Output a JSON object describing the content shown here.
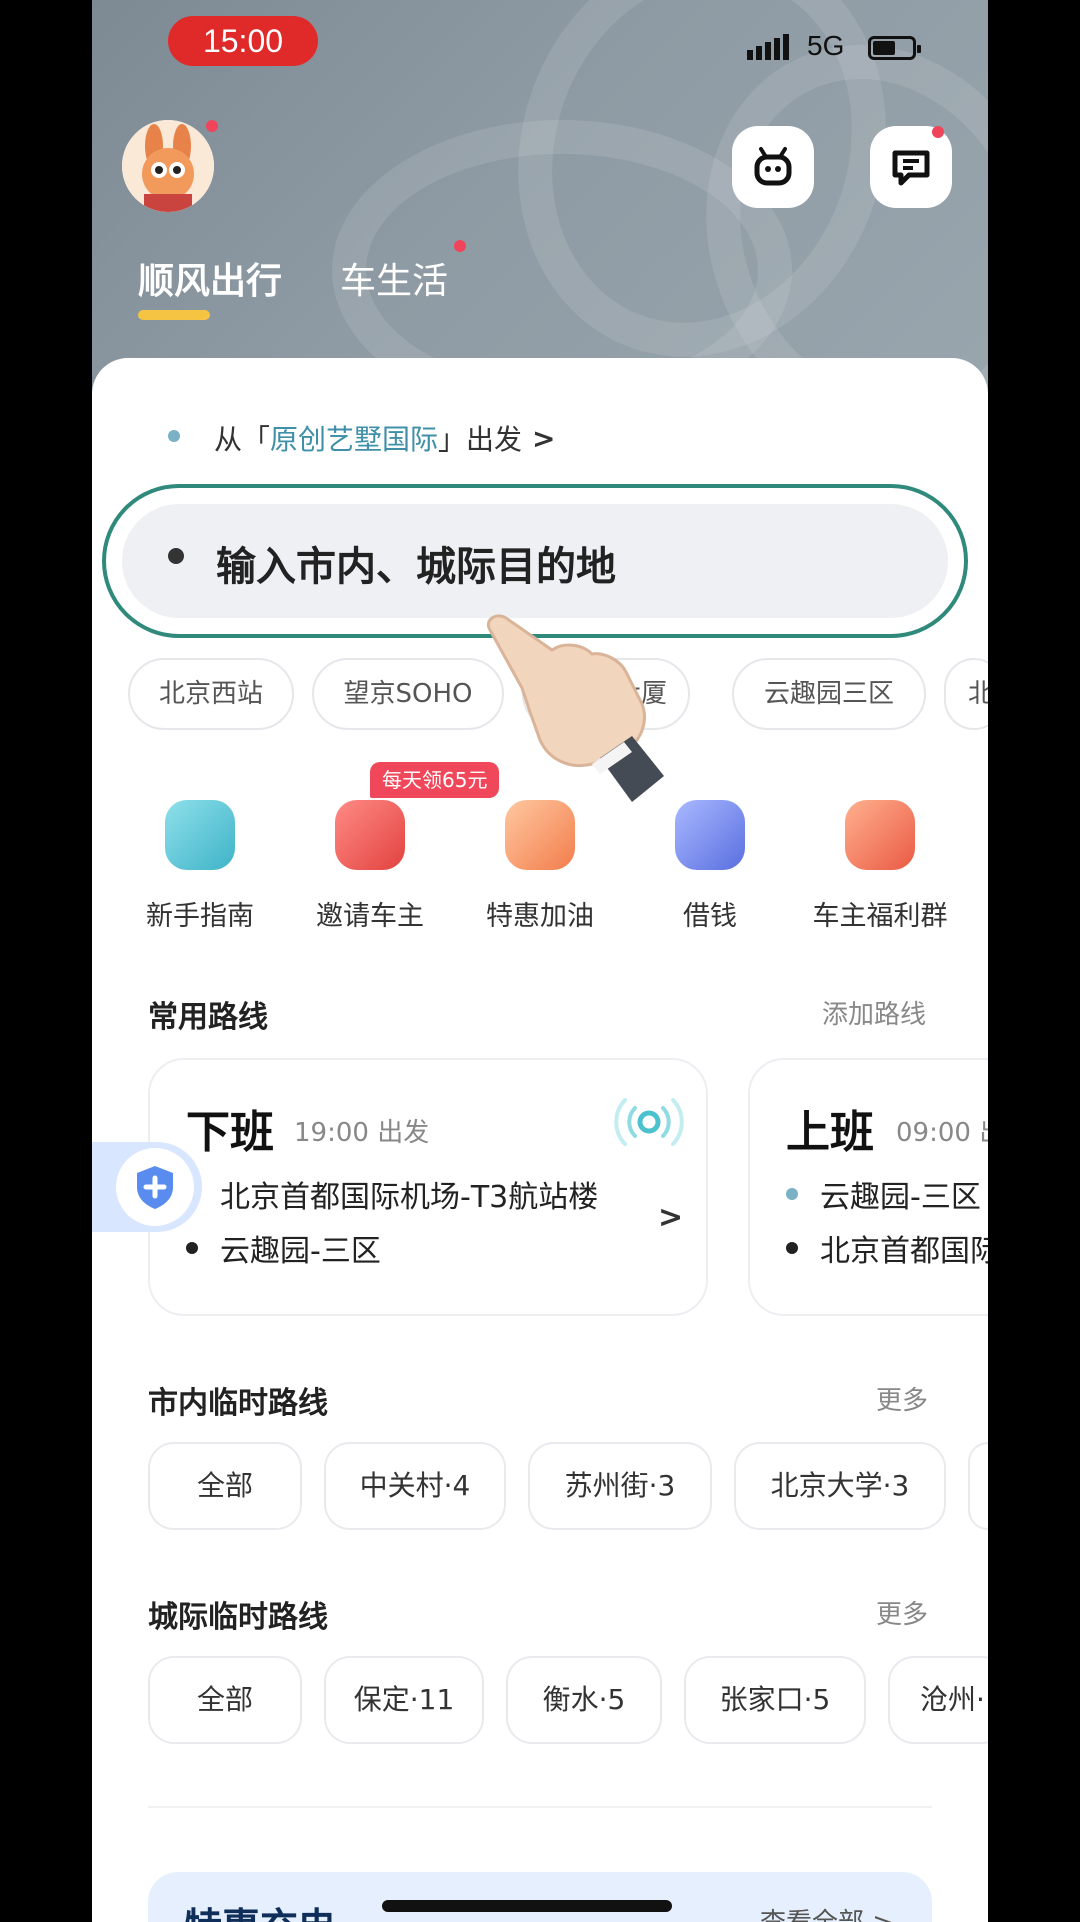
{
  "status_bar": {
    "time": "15:00",
    "network": "5G"
  },
  "header": {
    "tabs": [
      {
        "label": "顺风出行"
      },
      {
        "label": "车生活"
      }
    ]
  },
  "departure": {
    "prefix": "从「",
    "place": "原创艺墅国际",
    "suffix": "」出发",
    "chevron": ">"
  },
  "destination": {
    "placeholder": "输入市内、城际目的地"
  },
  "quick_places": [
    "北京西站",
    "望京SOHO",
    "大厦",
    "云趣园三区",
    "北"
  ],
  "shortcuts": {
    "promo_badge": "每天领65元",
    "items": [
      {
        "label": "新手指南",
        "icon": "guide-icon",
        "color": "#5cc6d6"
      },
      {
        "label": "邀请车主",
        "icon": "invite-icon",
        "color": "#ef5a57"
      },
      {
        "label": "特惠加油",
        "icon": "fuel-icon",
        "color": "#f6986a"
      },
      {
        "label": "借钱",
        "icon": "wallet-icon",
        "color": "#6c84e8"
      },
      {
        "label": "车主福利群",
        "icon": "group-icon",
        "color": "#f27559"
      }
    ]
  },
  "common_routes": {
    "title": "常用路线",
    "action": "添加路线",
    "cards": [
      {
        "name": "下班",
        "time": "19:00 出发",
        "from": "北京首都国际机场-T3航站楼",
        "to": "云趣园-三区",
        "chevron": ">"
      },
      {
        "name": "上班",
        "time": "09:00 出",
        "from": "云趣园-三区",
        "to": "北京首都国际"
      }
    ]
  },
  "city_routes": {
    "title": "市内临时路线",
    "more": "更多",
    "items": [
      "全部",
      "中关村·4",
      "苏州街·3",
      "北京大学·3"
    ]
  },
  "intercity_routes": {
    "title": "城际临时路线",
    "more": "更多",
    "items": [
      "全部",
      "保定·11",
      "衡水·5",
      "张家口·5",
      "沧州·"
    ]
  },
  "promo_section": {
    "title": "特惠充电",
    "more": "查看全部 >"
  },
  "colors": {
    "accent_teal": "#2f8a7c",
    "promo_red": "#f0485a",
    "tab_underline": "#f5c443"
  }
}
